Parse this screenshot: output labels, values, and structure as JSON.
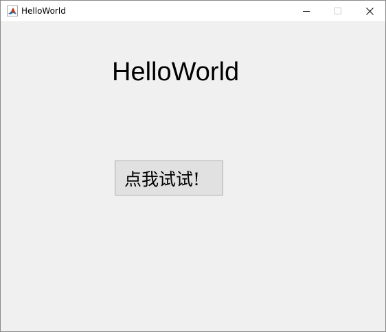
{
  "window": {
    "title": "HelloWorld",
    "controls": {
      "minimize": "minimize-icon",
      "maximize": "maximize-icon",
      "close": "close-icon"
    }
  },
  "content": {
    "label": "HelloWorld",
    "button_label": "点我试试!"
  },
  "colors": {
    "titlebar_bg": "#ffffff",
    "client_bg": "#f0f0f0",
    "button_bg": "#e1e1e1",
    "button_border": "#adadad"
  }
}
